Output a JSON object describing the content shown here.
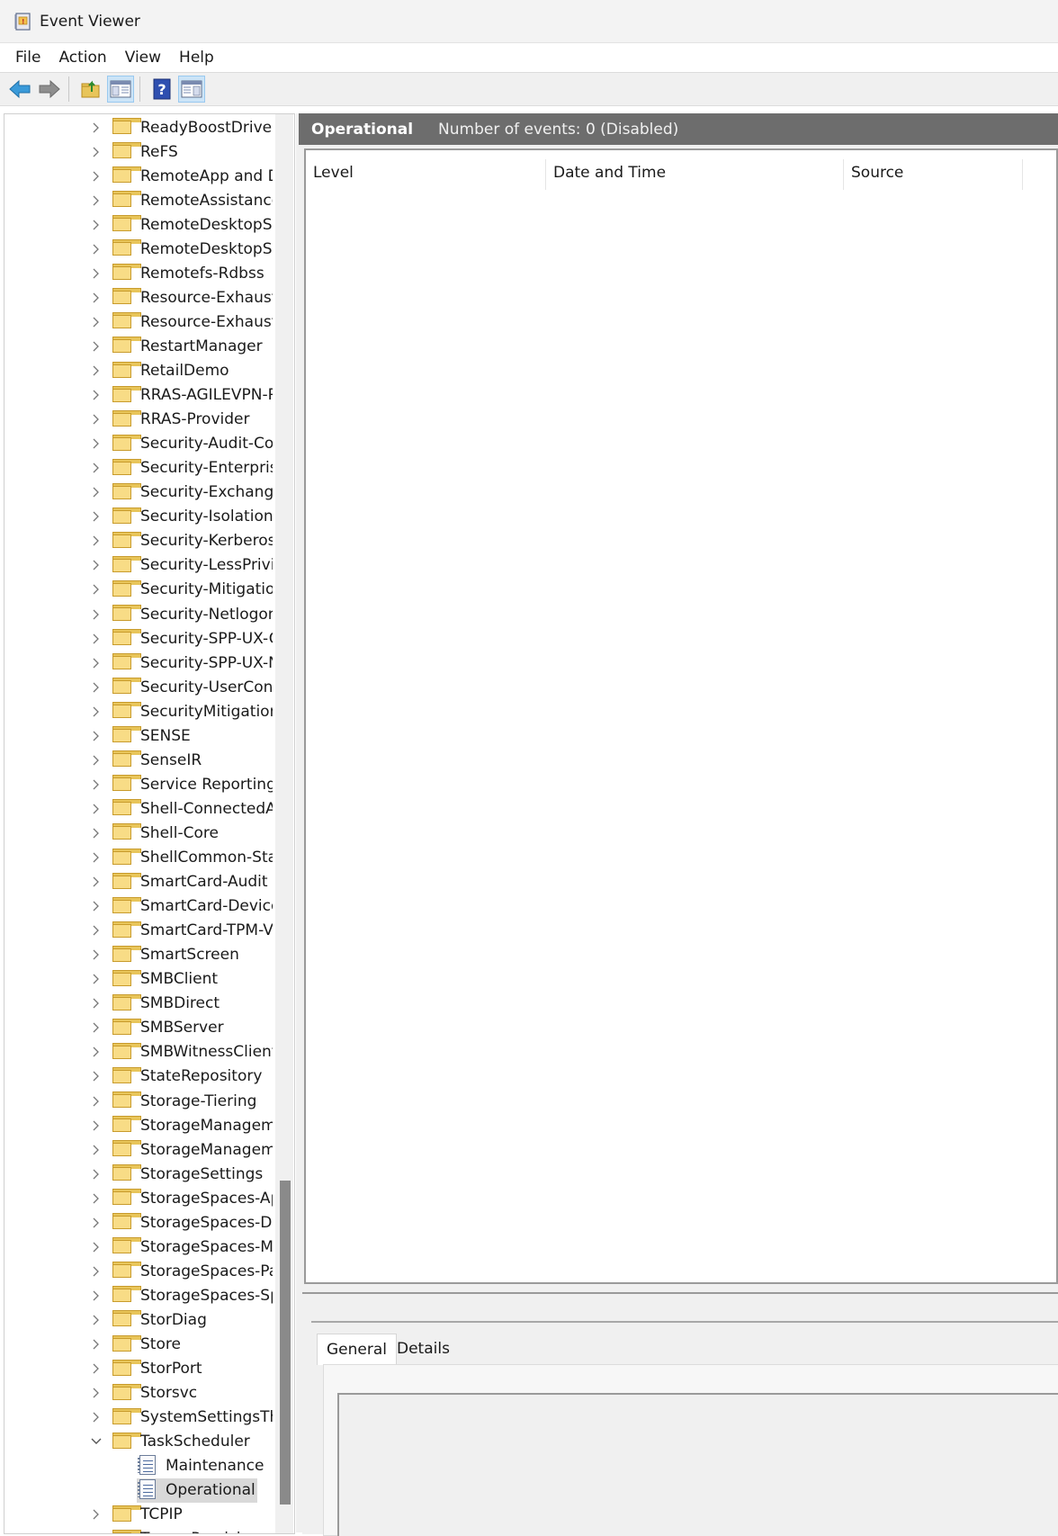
{
  "window": {
    "title": "Event Viewer"
  },
  "menu": [
    "File",
    "Action",
    "View",
    "Help"
  ],
  "toolbar": {
    "buttons": [
      "back-arrow-icon",
      "forward-arrow-icon",
      "open-folder-icon",
      "show-hide-console-tree-icon",
      "help-icon",
      "show-hide-action-pane-icon"
    ]
  },
  "tree": {
    "items": [
      "ReadyBoostDriver",
      "ReFS",
      "RemoteApp and D",
      "RemoteAssistance",
      "RemoteDesktopSe",
      "RemoteDesktopSe",
      "Remotefs-Rdbss",
      "Resource-Exhausti",
      "Resource-Exhausti",
      "RestartManager",
      "RetailDemo",
      "RRAS-AGILEVPN-Pr",
      "RRAS-Provider",
      "Security-Audit-Cor",
      "Security-Enterprise",
      "Security-Exchange",
      "Security-Isolation-",
      "Security-Kerberos",
      "Security-LessPrivile",
      "Security-Mitigation",
      "Security-Netlogon",
      "Security-SPP-UX-G",
      "Security-SPP-UX-N",
      "Security-UserCons",
      "SecurityMitigation",
      "SENSE",
      "SenseIR",
      "Service Reporting /",
      "Shell-ConnectedAc",
      "Shell-Core",
      "ShellCommon-Star",
      "SmartCard-Audit",
      "SmartCard-DeviceE",
      "SmartCard-TPM-VC",
      "SmartScreen",
      "SMBClient",
      "SMBDirect",
      "SMBServer",
      "SMBWitnessClient",
      "StateRepository",
      "Storage-Tiering",
      "StorageManageme",
      "StorageManageme",
      "StorageSettings",
      "StorageSpaces-Api",
      "StorageSpaces-Dri",
      "StorageSpaces-Ma",
      "StorageSpaces-Par",
      "StorageSpaces-Spa",
      "StorDiag",
      "Store",
      "StorPort",
      "Storsvc",
      "SystemSettingsThr",
      "TaskScheduler"
    ],
    "expanded_item": "TaskScheduler",
    "children": [
      "Maintenance",
      "Operational"
    ],
    "selected_child": "Operational",
    "after": [
      "TCPIP",
      "Terms-Provisio"
    ]
  },
  "events": {
    "log_name": "Operational",
    "count_text": "Number of events: 0 (Disabled)",
    "columns": [
      "Level",
      "Date and Time",
      "Source"
    ]
  },
  "details": {
    "tabs": [
      "General",
      "Details"
    ],
    "active_tab": "General"
  }
}
